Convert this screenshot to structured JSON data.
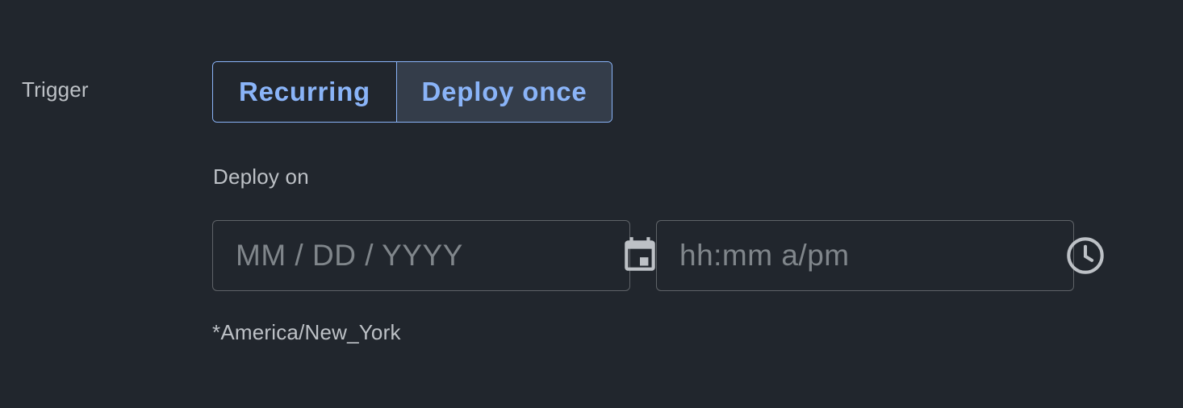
{
  "trigger": {
    "label": "Trigger",
    "options": [
      {
        "label": "Recurring",
        "selected": false
      },
      {
        "label": "Deploy once",
        "selected": true
      }
    ]
  },
  "schedule": {
    "label": "Deploy on",
    "date_field": {
      "value": "",
      "placeholder": "MM / DD / YYYY",
      "icon": "calendar-icon"
    },
    "time_field": {
      "value": "",
      "placeholder": "hh:mm a/pm",
      "icon": "clock-icon"
    },
    "timezone_note": "*America/New_York"
  },
  "colors": {
    "background": "#21262d",
    "accent": "#8ab4f8",
    "selected_fill": "#343d4a",
    "field_border": "#5f6368",
    "label_text": "#bdc1c6",
    "placeholder_text": "#80868b",
    "icon": "#bdc1c6"
  }
}
